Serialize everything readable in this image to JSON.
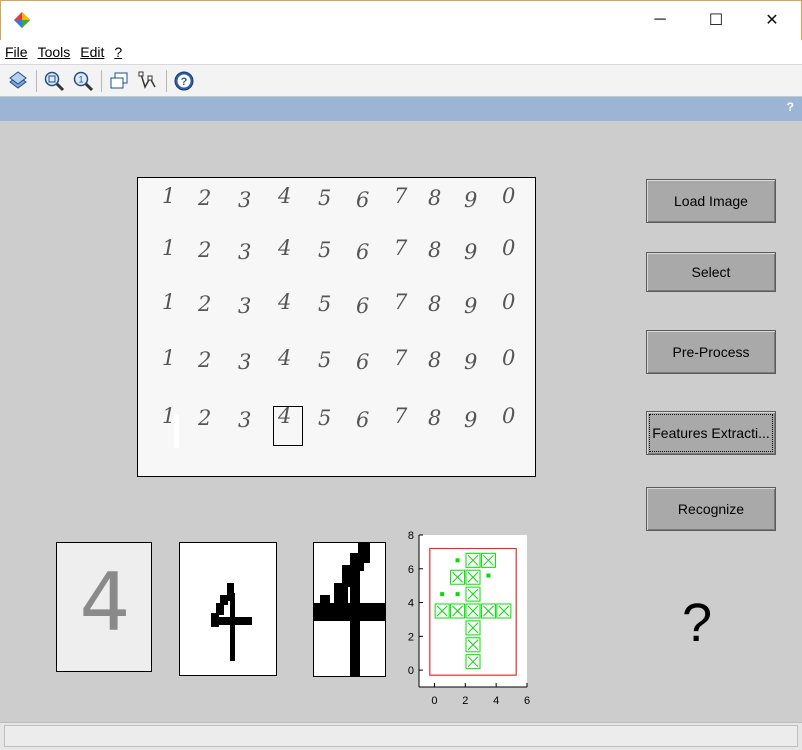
{
  "window": {
    "minimize_glyph": "─",
    "maximize_glyph": "☐",
    "close_glyph": "✕"
  },
  "menu": {
    "items": [
      {
        "label": "File"
      },
      {
        "label": "Tools"
      },
      {
        "label": "Edit"
      },
      {
        "label": "?"
      }
    ]
  },
  "toolbar": {
    "icons": [
      "rotate-icon",
      "zoom-in-icon",
      "zoom-reset-icon",
      "windows-icon",
      "datatips-icon",
      "help-icon"
    ]
  },
  "blue_strip": {
    "help_glyph": "?"
  },
  "buttons": {
    "load_image": "Load Image",
    "select": "Select",
    "pre_process": "Pre-Process",
    "features_extraction": "Features Extracti...",
    "recognize": "Recognize"
  },
  "image": {
    "rows": [
      [
        "1",
        "2",
        "3",
        "4",
        "5",
        "6",
        "7",
        "8",
        "9",
        "0"
      ],
      [
        "1",
        "2",
        "3",
        "4",
        "5",
        "6",
        "7",
        "8",
        "9",
        "0"
      ],
      [
        "1",
        "2",
        "3",
        "4",
        "5",
        "6",
        "7",
        "8",
        "9",
        "0"
      ],
      [
        "1",
        "2",
        "3",
        "4",
        "5",
        "6",
        "7",
        "8",
        "9",
        "0"
      ],
      [
        "1",
        "2",
        "3",
        "4",
        "5",
        "6",
        "7",
        "8",
        "9",
        "0"
      ]
    ],
    "selected_digit": "4"
  },
  "thumbs": {
    "glyph": "4"
  },
  "result": {
    "label": "?"
  },
  "chart_data": {
    "type": "scatter",
    "xlim": [
      -1,
      6
    ],
    "ylim": [
      -1,
      8
    ],
    "xticks": [
      "0",
      "2",
      "4",
      "6"
    ],
    "yticks": [
      "0",
      "2",
      "4",
      "6",
      "8"
    ],
    "box": {
      "x0": -0.3,
      "x1": 5.3,
      "y0": -0.3,
      "y1": 7.2
    },
    "points": [
      {
        "x": 2.5,
        "y": 6.5,
        "size": "large"
      },
      {
        "x": 3.5,
        "y": 6.5,
        "size": "large"
      },
      {
        "x": 1.5,
        "y": 5.5,
        "size": "large"
      },
      {
        "x": 2.5,
        "y": 5.5,
        "size": "large"
      },
      {
        "x": 2.5,
        "y": 4.5,
        "size": "large"
      },
      {
        "x": 0.5,
        "y": 3.5,
        "size": "large"
      },
      {
        "x": 1.5,
        "y": 3.5,
        "size": "large"
      },
      {
        "x": 2.5,
        "y": 3.5,
        "size": "large"
      },
      {
        "x": 3.5,
        "y": 3.5,
        "size": "large"
      },
      {
        "x": 4.5,
        "y": 3.5,
        "size": "large"
      },
      {
        "x": 2.5,
        "y": 2.5,
        "size": "large"
      },
      {
        "x": 2.5,
        "y": 1.5,
        "size": "large"
      },
      {
        "x": 2.5,
        "y": 0.5,
        "size": "large"
      },
      {
        "x": 1.5,
        "y": 6.5,
        "size": "small"
      },
      {
        "x": 0.5,
        "y": 4.5,
        "size": "small"
      },
      {
        "x": 1.5,
        "y": 4.5,
        "size": "small"
      },
      {
        "x": 3.5,
        "y": 5.6,
        "size": "small"
      }
    ],
    "marker_color": "#00e000",
    "box_color": "#e03030"
  }
}
